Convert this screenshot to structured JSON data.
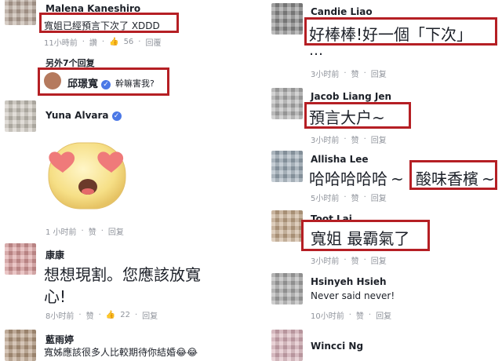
{
  "left": {
    "c1": {
      "name": "Malena Kaneshiro",
      "text": "寬姐已經預言下次了 XDDD",
      "time": "11小時前",
      "like": "讚",
      "count": "56",
      "reply": "回覆"
    },
    "more_replies": "另外7个回复",
    "r1": {
      "name": "邱璟寬",
      "text": "幹嘛害我?"
    },
    "c2": {
      "name": "Yuna Alvara",
      "time": "1 小时前",
      "like": "赞",
      "reply": "回复"
    },
    "c3": {
      "name": "康康",
      "line1": "想想現割。您應該放寬",
      "line2": "心!",
      "time": "8小时前",
      "like": "赞",
      "count": "22",
      "reply": "回复"
    },
    "c4": {
      "name": "藍雨婷",
      "text": "寬姊應該很多人比較期待你結婚😂😂"
    }
  },
  "right": {
    "c1": {
      "name": "Candie Liao",
      "line1": "好棒棒!好一個「下次」",
      "line2": "…",
      "time": "3小时前",
      "like": "赞",
      "reply": "回复"
    },
    "c2": {
      "name": "Jacob Liang Jen",
      "text": "預言大户~",
      "time": "3小时前",
      "like": "赞",
      "reply": "回复"
    },
    "c3": {
      "name": "Allisha Lee",
      "text_a": "哈哈哈哈哈",
      "text_b": "~",
      "text_c": "酸味香檳",
      "text_d": "~",
      "time": "5小时前",
      "like": "赞",
      "reply": "回复"
    },
    "c4": {
      "name": "Toot Lai",
      "text": "寬姐 最霸氣了",
      "time": "3小时前",
      "like": "赞",
      "reply": "回复"
    },
    "c5": {
      "name": "Hsinyeh Hsieh",
      "text": "Never said never!",
      "time": "10小时前",
      "like": "赞",
      "reply": "回复"
    },
    "c6": {
      "name": "Wincci Ng"
    }
  },
  "colors": {
    "highlight": "#b51f24",
    "meta": "#90949c",
    "verified": "#4b78e6"
  }
}
